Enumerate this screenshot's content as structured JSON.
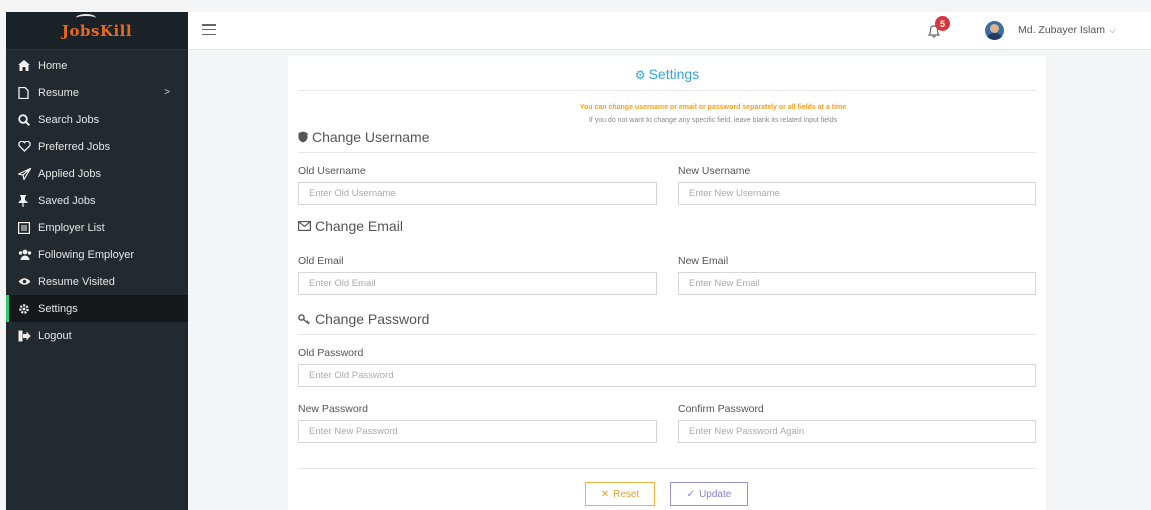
{
  "brand": {
    "logo_text": "JobsKill"
  },
  "sidebar": {
    "items": [
      {
        "label": "Home",
        "icon": "home-icon"
      },
      {
        "label": "Resume",
        "icon": "file-icon",
        "chevron": ">"
      },
      {
        "label": "Search Jobs",
        "icon": "search-icon"
      },
      {
        "label": "Preferred Jobs",
        "icon": "heart-icon"
      },
      {
        "label": "Applied Jobs",
        "icon": "paper-plane-icon"
      },
      {
        "label": "Saved Jobs",
        "icon": "pin-icon"
      },
      {
        "label": "Employer List",
        "icon": "list-icon"
      },
      {
        "label": "Following Employer",
        "icon": "users-icon"
      },
      {
        "label": "Resume Visited",
        "icon": "eye-icon"
      },
      {
        "label": "Settings",
        "icon": "gear-icon",
        "active": true
      },
      {
        "label": "Logout",
        "icon": "sign-out-icon"
      }
    ]
  },
  "topbar": {
    "notification_count": "5",
    "user_name": "Md. Zubayer Islam",
    "caret": "⌵"
  },
  "settings": {
    "title": "Settings",
    "notice": "You can change username or email or password separately or all fields at a time",
    "notice_sub": "If you do not want to change any specific field, leave blank its related input fields",
    "username_section": {
      "heading": "Change Username",
      "old_label": "Old Username",
      "old_placeholder": "Enter Old Username",
      "new_label": "New Username",
      "new_placeholder": "Enter New Username"
    },
    "email_section": {
      "heading": "Change Email",
      "old_label": "Old Email",
      "old_placeholder": "Enter Old Email",
      "new_label": "New Email",
      "new_placeholder": "Enter New Email"
    },
    "password_section": {
      "heading": "Change Password",
      "old_label": "Old Password",
      "old_placeholder": "Enter Old Password",
      "new_label": "New Password",
      "new_placeholder": "Enter New Password",
      "confirm_label": "Confirm Password",
      "confirm_placeholder": "Enter New Password Again"
    },
    "reset_label": "Reset",
    "update_label": "Update"
  },
  "colors": {
    "sidebar_bg": "#222a2f",
    "active_indicator": "#2ecc71",
    "title_accent": "#33a4d6",
    "notice": "#f0a020",
    "badge": "#d9363e"
  }
}
